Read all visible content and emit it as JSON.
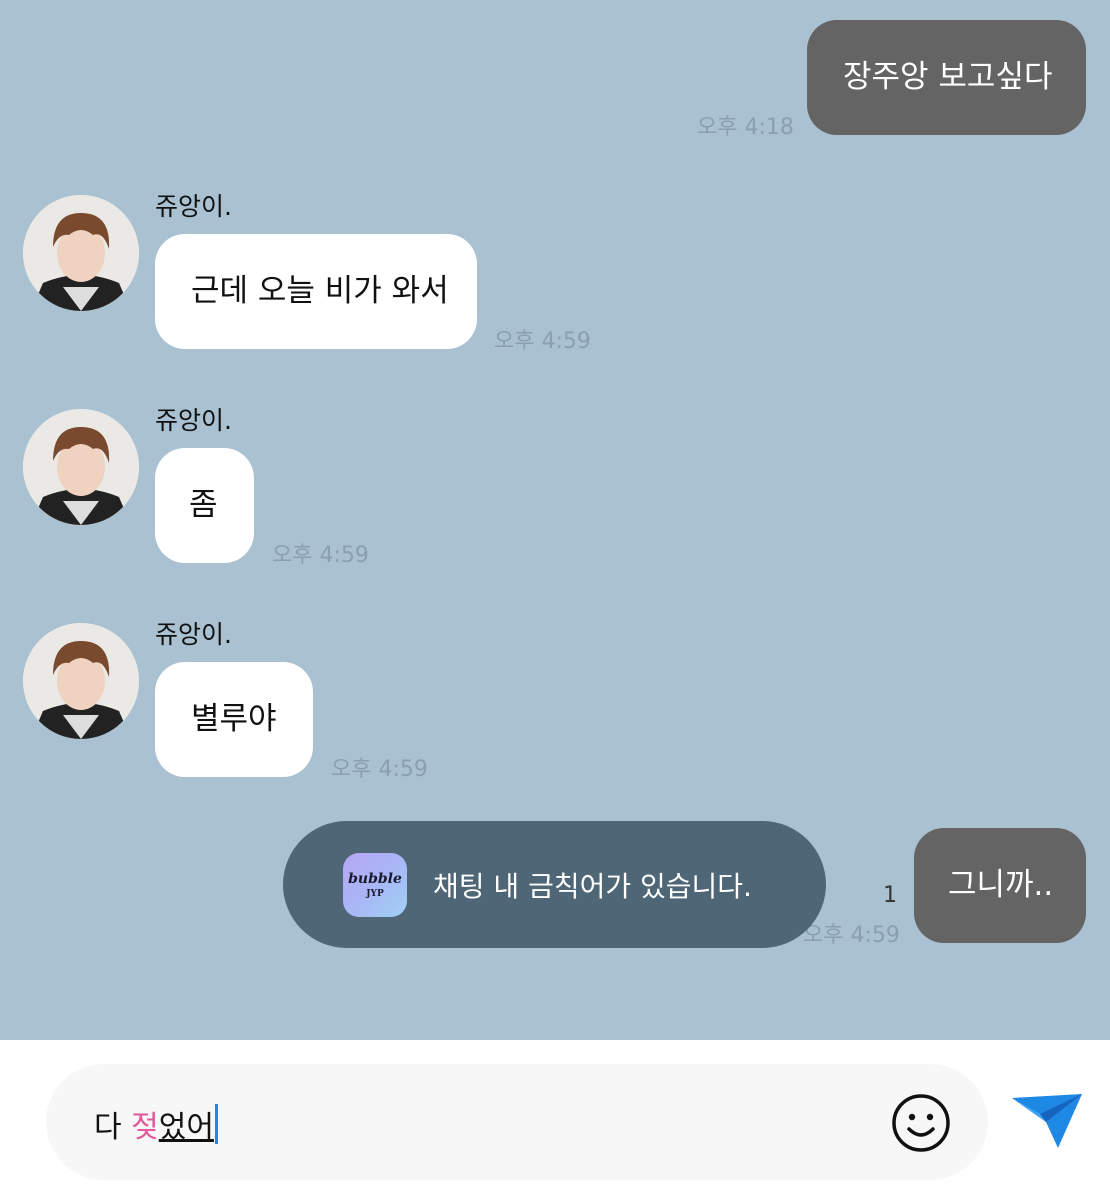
{
  "sender_name": "쥬앙이.",
  "messages": [
    {
      "side": "mine",
      "text": "장주앙 보고싶다",
      "time": "오후 4:18"
    },
    {
      "side": "theirs",
      "text": "근데 오늘 비가 와서",
      "time": "오후 4:59"
    },
    {
      "side": "theirs",
      "text": "좀",
      "time": "오후 4:59"
    },
    {
      "side": "theirs",
      "text": "별루야",
      "time": "오후 4:59"
    },
    {
      "side": "mine",
      "text": "그니까..",
      "time": "오후 4:59",
      "unread": "1"
    }
  ],
  "toast": {
    "logo_text": "bubble",
    "logo_sub": "JYP",
    "message": "채팅 내 금칙어가 있습니다."
  },
  "input": {
    "prefix": "다 ",
    "flagged": "젖",
    "composing": "었어"
  },
  "icons": {
    "emoji": "smiley-face-icon",
    "send": "paper-plane-icon"
  },
  "colors": {
    "background": "#a9c1d1",
    "my_bubble": "#646464",
    "their_bubble": "#ffffff",
    "toast": "#4e6676",
    "send": "#1e88e5",
    "flagged_text": "#e2589b"
  }
}
